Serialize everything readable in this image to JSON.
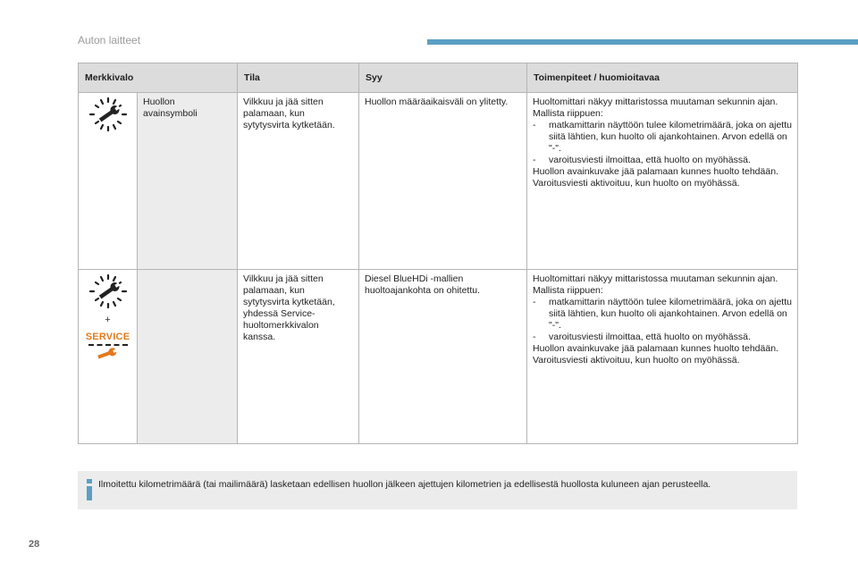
{
  "header": {
    "section_title": "Auton laitteet"
  },
  "table": {
    "headers": [
      "Merkkivalo",
      "Tila",
      "Syy",
      "Toimenpiteet / huomioitavaa"
    ],
    "rows": [
      {
        "icon": "wrench-flash-icon",
        "name": "Huollon avainsymboli",
        "state": "Vilkkuu ja jää sitten palamaan, kun sytytysvirta kytketään.",
        "cause": "Huollon määräaikaisväli on ylitetty.",
        "actions": {
          "intro": "Huoltomittari näkyy mittaristossa muutaman sekunnin ajan. Mallista riippuen:",
          "bullets": [
            "matkamittarin näyttöön tulee kilometrimäärä, joka on ajettu siitä lähtien, kun huolto oli ajankohtainen. Arvon edellä on \"-\".",
            "varoitusviesti ilmoittaa, että huolto on myöhässä."
          ],
          "line1": "Huollon avainkuvake jää palamaan kunnes huolto tehdään.",
          "line2": "Varoitusviesti aktivoituu, kun huolto on myöhässä."
        }
      },
      {
        "icon": "wrench-flash-service-icon",
        "plus": "+",
        "service_label": "SERVICE",
        "name": "",
        "state": "Vilkkuu ja jää sitten palamaan, kun sytytysvirta kytketään, yhdessä Service-huoltomerkkivalon kanssa.",
        "cause": "Diesel BlueHDi -mallien huoltoajankohta on ohitettu.",
        "actions": {
          "intro": "Huoltomittari näkyy mittaristossa muutaman sekunnin ajan. Mallista riippuen:",
          "bullets": [
            "matkamittarin näyttöön tulee kilometrimäärä, joka on ajettu siitä lähtien, kun huolto oli ajankohtainen. Arvon edellä on \"-\".",
            "varoitusviesti ilmoittaa, että huolto on myöhässä."
          ],
          "line1": "Huollon avainkuvake jää palamaan kunnes huolto tehdään.",
          "line2": "Varoitusviesti aktivoituu, kun huolto on myöhässä."
        }
      }
    ]
  },
  "info": {
    "icon": "info-icon",
    "text": "Ilmoitettu kilometrimäärä (tai mailimäärä) lasketaan edellisen huollon jälkeen ajettujen kilometrien ja edellisestä huollosta kuluneen ajan perusteella."
  },
  "page_number": "28",
  "colors": {
    "accent": "#5b9fc4",
    "service": "#e27a1c"
  }
}
